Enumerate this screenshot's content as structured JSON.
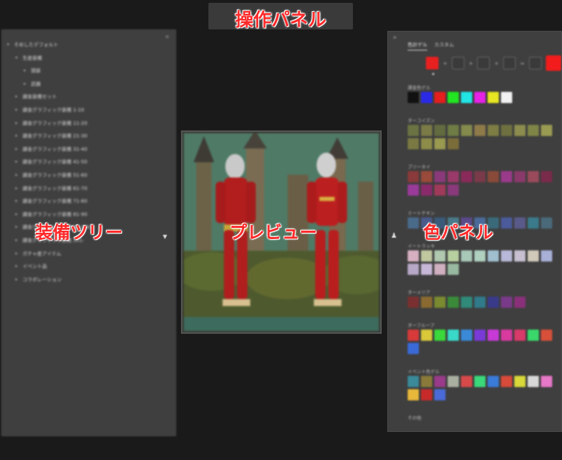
{
  "overlay_labels": {
    "toolbar": "操作パネル",
    "tree": "装備ツリー",
    "preview": "プレビュー",
    "color_panel": "色パネル"
  },
  "icons": {
    "collapse_left": "double-chevron-left-icon",
    "collapse_right": "double-chevron-right-icon",
    "tree_handle": "triangle-right-icon",
    "color_handle": "palette-icon"
  },
  "tree": {
    "items": [
      {
        "label": "そめしたデフォルト",
        "level": 0,
        "arrow": "▾"
      },
      {
        "label": "生産装備",
        "level": 1,
        "arrow": "▾"
      },
      {
        "label": "頭装",
        "level": 2,
        "arrow": "▸"
      },
      {
        "label": "武器",
        "level": 2,
        "arrow": "▸"
      },
      {
        "label": "課金装備セット",
        "level": 1,
        "arrow": "▸"
      },
      {
        "label": "課金グラフィック装備 1-10",
        "level": 1,
        "arrow": "▸"
      },
      {
        "label": "課金グラフィック装備 11-20",
        "level": 1,
        "arrow": "▸"
      },
      {
        "label": "課金グラフィック装備 21-30",
        "level": 1,
        "arrow": "▸"
      },
      {
        "label": "課金グラフィック装備 31-40",
        "level": 1,
        "arrow": "▸"
      },
      {
        "label": "課金グラフィック装備 41-50",
        "level": 1,
        "arrow": "▸"
      },
      {
        "label": "課金グラフィック装備 51-60",
        "level": 1,
        "arrow": "▸"
      },
      {
        "label": "課金グラフィック装備 61-70",
        "level": 1,
        "arrow": "▸"
      },
      {
        "label": "課金グラフィック装備 71-80",
        "level": 1,
        "arrow": "▸"
      },
      {
        "label": "課金グラフィック装備 81-90",
        "level": 1,
        "arrow": "▸"
      },
      {
        "label": "課金グラフィック装備 91-100",
        "level": 1,
        "arrow": "▸"
      },
      {
        "label": "課金グラフィック装備 101-",
        "level": 1,
        "arrow": "▸"
      },
      {
        "label": "ガチャ産アイテム",
        "level": 1,
        "arrow": "▸"
      },
      {
        "label": "イベント品",
        "level": 1,
        "arrow": "▸"
      },
      {
        "label": "コラボレーション",
        "level": 1,
        "arrow": "▸"
      }
    ]
  },
  "color_panel": {
    "tabs": [
      {
        "label": "色計ゲル",
        "active": true
      },
      {
        "label": "カスタム",
        "active": false
      }
    ],
    "mixer": {
      "slots": [
        "#e82020",
        "",
        "",
        "",
        ""
      ],
      "result": "#f21c1c",
      "ops": [
        "+",
        "+",
        "+",
        "="
      ]
    },
    "sections": [
      {
        "title": "課金色ゲル",
        "colors": [
          "#111111",
          "#2a2ae6",
          "#e61e1e",
          "#22e622",
          "#22e6e6",
          "#e622e6",
          "#e6e622",
          "#f2f2f2"
        ]
      },
      {
        "title": "ターコイズン",
        "colors": [
          "#6b7343",
          "#7a7b47",
          "#626b3f",
          "#6f7c45",
          "#838a4c",
          "#8f7a4a",
          "#7d7d44",
          "#6e7040",
          "#8c8c4e",
          "#7f8546",
          "#9a9b52",
          "#7a7943",
          "#8d8c49",
          "#9a9950",
          "#7b6d3a"
        ]
      },
      {
        "title": "ブリーネイ",
        "colors": [
          "#8a3a3a",
          "#9a4a3a",
          "#8a3a7a",
          "#9a3a6a",
          "#8a2a5a",
          "#7a3a4a",
          "#8a4a3a",
          "#9a3a8a",
          "#8a3a6a",
          "#9a4a5a",
          "#7a2a4a",
          "#9a3a9a",
          "#8a2a6a",
          "#a03a5a",
          "#8a3a7a"
        ]
      },
      {
        "title": "ミートチキン",
        "colors": [
          "#4a6a8a",
          "#4a5a8a",
          "#3a5a7a",
          "#4a7a8a",
          "#5a4a8a",
          "#4a6a9a",
          "#3a6a7a",
          "#4a5a9a",
          "#5a5a8a",
          "#3a7a8a",
          "#4a6a7a"
        ]
      },
      {
        "title": "イートラッキ",
        "colors": [
          "#d6b0c0",
          "#c0c8a0",
          "#b0c8b0",
          "#b8d0a0",
          "#a8c8b8",
          "#b0d0c0",
          "#a0c0d0",
          "#b8b8d8",
          "#c8c0d0",
          "#d0c8b8",
          "#a8b0d8",
          "#b8a8c8",
          "#c8b8d8",
          "#d0b0c0",
          "#98b8a0"
        ]
      },
      {
        "title": "ターメリア",
        "colors": [
          "#7a3030",
          "#8a6a30",
          "#7a8a30",
          "#3a8a3a",
          "#308a7a",
          "#307a8a",
          "#3a3a8a",
          "#7a3a8a",
          "#8a307a"
        ]
      },
      {
        "title": "ターフループ",
        "colors": [
          "#d83a3a",
          "#d8c83a",
          "#3ad83a",
          "#3ad8c8",
          "#3a8ad8",
          "#7a3ad8",
          "#c83ad8",
          "#d83aa0",
          "#d83a6a",
          "#3ad86a",
          "#d8503a",
          "#3a6ad8"
        ]
      },
      {
        "title": "イベント色ゲル",
        "colors": [
          "#3a8a9a",
          "#8a7a3a",
          "#9a3a8a",
          "#aab0a0",
          "#d84a4a",
          "#3ad87a",
          "#3a7ad8",
          "#d84a3a",
          "#d8d83a",
          "#d8d8d8",
          "#e878c8",
          "#e8b83a",
          "#c82a2a",
          "#4a6ad8"
        ]
      },
      {
        "title": "その他",
        "colors": []
      }
    ]
  }
}
